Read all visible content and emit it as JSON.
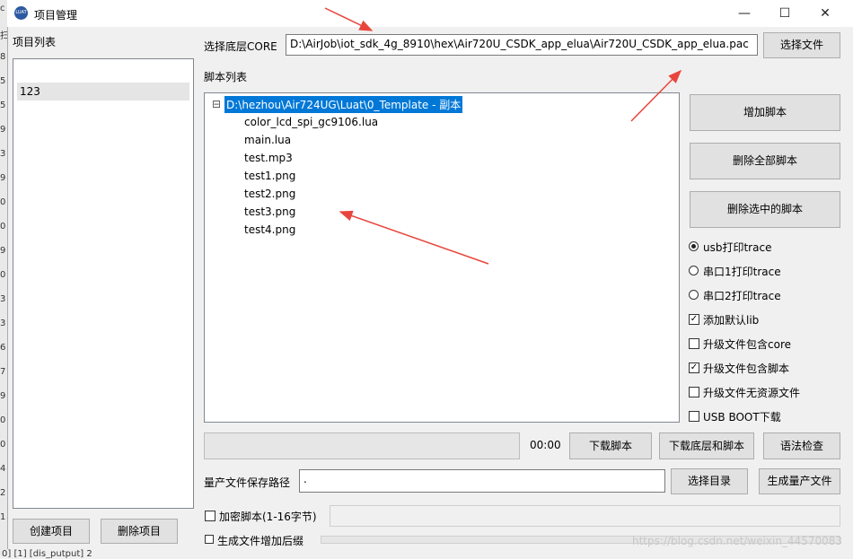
{
  "window": {
    "title": "项目管理",
    "app_icon": "luat-app-icon",
    "minimize": "—",
    "maximize": "☐",
    "close": "✕"
  },
  "project_list": {
    "label": "项目列表",
    "items": [
      "123"
    ],
    "create_button": "创建项目",
    "delete_button": "删除项目"
  },
  "core": {
    "label": "选择底层CORE",
    "path": "D:\\AirJob\\iot_sdk_4g_8910\\hex\\Air720U_CSDK_app_elua\\Air720U_CSDK_app_elua.pac",
    "choose_button": "选择文件"
  },
  "scripts": {
    "label": "脚本列表",
    "root": "D:\\hezhou\\Air724UG\\Luat\\0_Template - 副本",
    "collapse_glyph": "⊟",
    "files": [
      "color_lcd_spi_gc9106.lua",
      "main.lua",
      "test.mp3",
      "test1.png",
      "test2.png",
      "test3.png",
      "test4.png"
    ]
  },
  "side_buttons": {
    "add": "增加脚本",
    "delete_all": "删除全部脚本",
    "delete_selected": "删除选中的脚本"
  },
  "options": {
    "radio_usb": "usb打印trace",
    "radio_uart1": "串口1打印trace",
    "radio_uart2": "串口2打印trace",
    "chk_default_lib": "添加默认lib",
    "chk_upgrade_core": "升级文件包含core",
    "chk_upgrade_script": "升级文件包含脚本",
    "chk_no_resource": "升级文件无资源文件",
    "chk_usb_boot": "USB BOOT下载"
  },
  "download": {
    "time": "00:00",
    "progress": 0,
    "download_script": "下载脚本",
    "download_core_script": "下载底层和脚本",
    "syntax_check": "语法检查"
  },
  "production": {
    "label": "量产文件保存路径",
    "path": ".",
    "choose_dir": "选择目录",
    "generate": "生成量产文件"
  },
  "encrypt": {
    "label": "加密脚本(1-16字节)",
    "suffix_label": "生成文件增加后缀"
  },
  "background": {
    "left_chars": [
      "c",
      "扫",
      "8",
      "5",
      "5",
      "9",
      "3",
      "9",
      "0",
      "0",
      "9",
      "0",
      "3",
      "3",
      "6",
      "7",
      "9",
      "0",
      "0",
      "4",
      "2",
      "1"
    ],
    "bottom_text": "0] [1] [dis_putput] 2"
  },
  "watermark": "https://blog.csdn.net/weixin_44570083",
  "colors": {
    "selection": "#0078d7",
    "arrow": "#e8453c"
  }
}
